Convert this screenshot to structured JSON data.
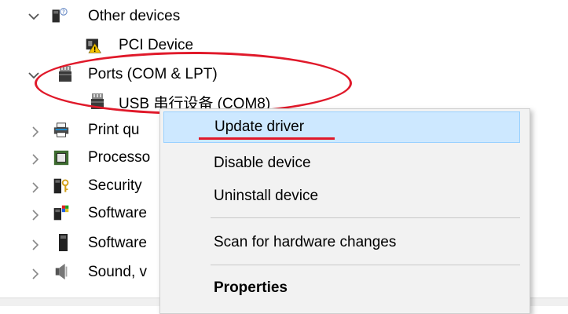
{
  "tree": {
    "items": [
      {
        "label": "Other devices",
        "expanded": true,
        "icon": "other-devices-icon"
      },
      {
        "label": "PCI Device",
        "icon": "warning-device-icon"
      },
      {
        "label": "Ports (COM & LPT)",
        "expanded": true,
        "icon": "port-icon"
      },
      {
        "label": "USB 串行设备 (COM8)",
        "icon": "port-icon"
      },
      {
        "label": "Print qu",
        "expanded": false,
        "icon": "printer-icon"
      },
      {
        "label": "Processo",
        "expanded": false,
        "icon": "processor-icon"
      },
      {
        "label": "Security",
        "expanded": false,
        "icon": "security-device-icon"
      },
      {
        "label": "Software",
        "expanded": false,
        "icon": "software-component-icon"
      },
      {
        "label": "Software",
        "expanded": false,
        "icon": "software-device-icon"
      },
      {
        "label": "Sound, v",
        "expanded": false,
        "icon": "sound-icon"
      }
    ]
  },
  "context_menu": {
    "items": [
      {
        "label": "Update driver",
        "highlighted": true
      },
      {
        "label": "Disable device"
      },
      {
        "label": "Uninstall device"
      },
      {
        "label": "Scan for hardware changes"
      },
      {
        "label": "Properties",
        "bold": true
      }
    ]
  },
  "colors": {
    "annotation": "#e0192a",
    "highlight": "#cde8ff",
    "menu_background": "#f2f2f2"
  }
}
